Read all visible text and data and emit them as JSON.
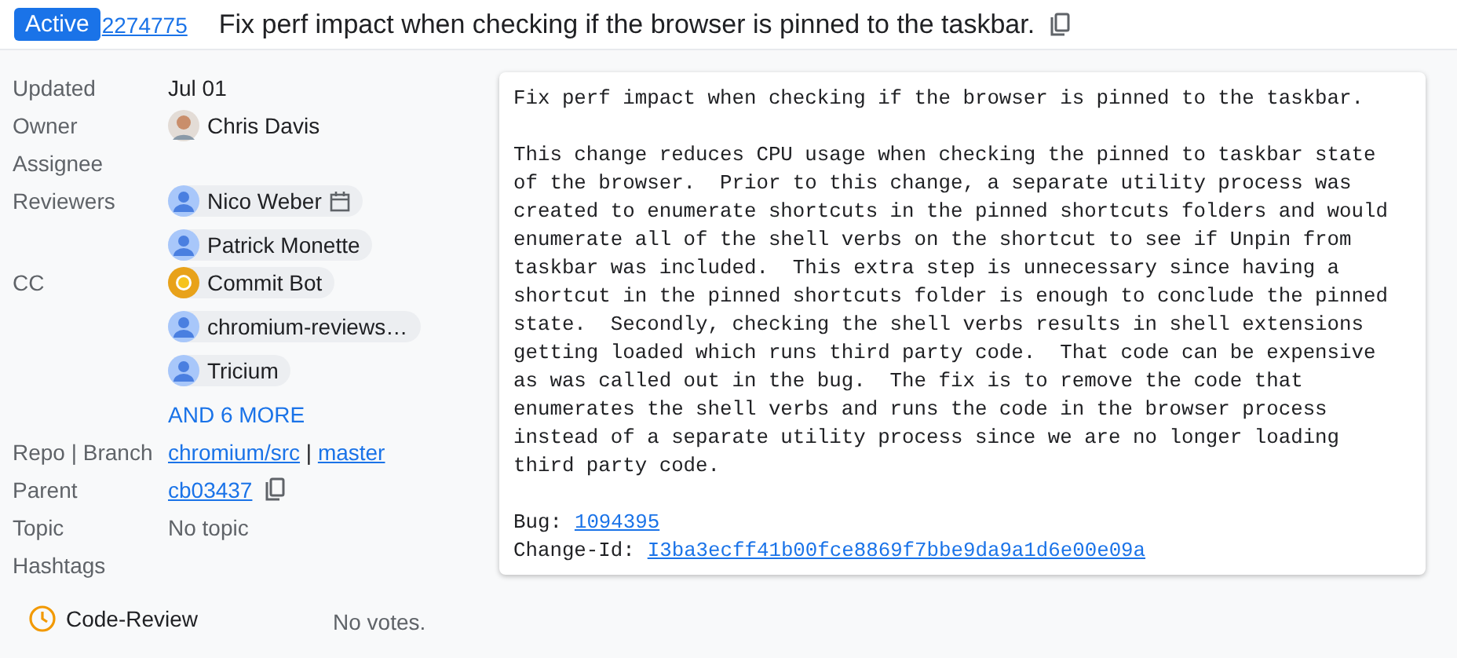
{
  "header": {
    "status": "Active",
    "change_number": "2274775",
    "title": "Fix perf impact when checking if the browser is pinned to the taskbar."
  },
  "fields": [
    {
      "label": "Updated",
      "kind": "text",
      "value": "Jul 01"
    },
    {
      "label": "Owner",
      "kind": "people",
      "people": [
        {
          "name": "Chris Davis",
          "kind": "photo",
          "chip": false,
          "calendar": false
        }
      ]
    },
    {
      "label": "Assignee",
      "kind": "empty"
    },
    {
      "label": "Reviewers",
      "kind": "people",
      "people": [
        {
          "name": "Nico Weber",
          "kind": "generic",
          "chip": true,
          "calendar": true
        },
        {
          "name": "Patrick Monette",
          "kind": "generic",
          "chip": true,
          "calendar": false
        }
      ]
    },
    {
      "label": "CC",
      "kind": "people",
      "people": [
        {
          "name": "Commit Bot",
          "kind": "bot",
          "chip": true,
          "calendar": false
        },
        {
          "name": "chromium-reviews…",
          "kind": "generic",
          "chip": true,
          "calendar": false
        },
        {
          "name": "Tricium",
          "kind": "generic",
          "chip": true,
          "calendar": false
        }
      ],
      "more": "AND 6 MORE"
    },
    {
      "label": "Repo | Branch",
      "kind": "repo",
      "repo": "chromium/src",
      "separator": "|",
      "branch": "master"
    },
    {
      "label": "Parent",
      "kind": "commit",
      "value": "cb03437"
    },
    {
      "label": "Topic",
      "kind": "muted",
      "value": "No topic"
    },
    {
      "label": "Hashtags",
      "kind": "empty"
    }
  ],
  "votes": {
    "label": "Code-Review",
    "value": "No votes."
  },
  "message": {
    "paragraphs": [
      "Fix perf impact when checking if the browser is pinned to the taskbar.",
      "This change reduces CPU usage when checking the pinned to taskbar state\nof the browser.  Prior to this change, a separate utility process was\ncreated to enumerate shortcuts in the pinned shortcuts folders and would\nenumerate all of the shell verbs on the shortcut to see if Unpin from\ntaskbar was included.  This extra step is unnecessary since having a\nshortcut in the pinned shortcuts folder is enough to conclude the pinned\nstate.  Secondly, checking the shell verbs results in shell extensions\ngetting loaded which runs third party code.  That code can be expensive\nas was called out in the bug.  The fix is to remove the code that\nenumerates the shell verbs and runs the code in the browser process\ninstead of a separate utility process since we are no longer loading\nthird party code."
    ],
    "footers": [
      {
        "key": "Bug:",
        "value": "1094395"
      },
      {
        "key": "Change-Id:",
        "value": "I3ba3ecff41b00fce8869f7bbe9da9a1d6e00e09a"
      }
    ]
  }
}
